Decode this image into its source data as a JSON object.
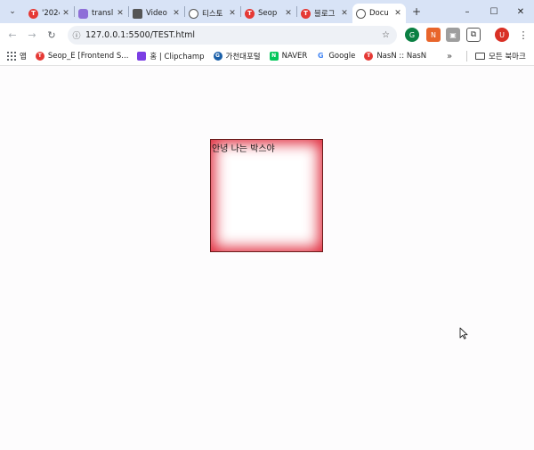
{
  "browser": {
    "tabs": [
      {
        "title": "'2024",
        "favicon_color": "#e53935",
        "favicon_glyph": "T",
        "active": false
      },
      {
        "title": "transl",
        "favicon_color": "#8e6fd8",
        "favicon_glyph": "",
        "active": false
      },
      {
        "title": "Video",
        "favicon_color": "#555555",
        "favicon_glyph": "",
        "active": false
      },
      {
        "title": "티스토",
        "favicon_color": "#666666",
        "favicon_glyph": "",
        "active": false
      },
      {
        "title": "Seop",
        "favicon_color": "#e53935",
        "favicon_glyph": "T",
        "active": false
      },
      {
        "title": "블로그",
        "favicon_color": "#e53935",
        "favicon_glyph": "T",
        "active": false
      },
      {
        "title": "Docu",
        "favicon_color": "#555555",
        "favicon_glyph": "",
        "active": true
      }
    ],
    "new_tab_label": "+",
    "window_controls": {
      "minimize": "–",
      "maximize": "☐",
      "close": "✕"
    },
    "address": "127.0.0.1:5500/TEST.html",
    "profile_initial": "U"
  },
  "bookmarks": {
    "apps_label": "앱",
    "items": [
      {
        "label": "Seop_E [Frontend S...",
        "favicon_color": "#e53935",
        "glyph": "T"
      },
      {
        "label": "홈 | Clipchamp",
        "favicon_color": "#7b3fe4",
        "glyph": ""
      },
      {
        "label": "가천대포털",
        "favicon_color": "#1a5fa8",
        "glyph": "G"
      },
      {
        "label": "NAVER",
        "favicon_color": "#03c75a",
        "glyph": "N"
      },
      {
        "label": "Google",
        "favicon_color": "#4285f4",
        "glyph": "G"
      },
      {
        "label": "NasN :: NasN",
        "favicon_color": "#e53935",
        "glyph": "T"
      }
    ],
    "more_label": "»",
    "all_bookmarks_label": "모든 북마크"
  },
  "page": {
    "box_text": "안녕 나는 박스야",
    "box_shadow_color": "#e0283a"
  }
}
